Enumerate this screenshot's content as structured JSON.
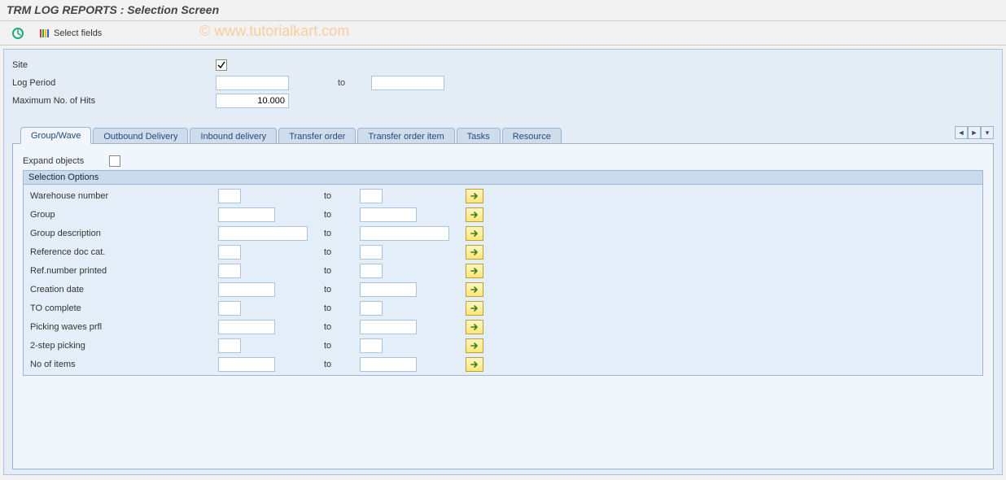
{
  "header": {
    "title": "TRM LOG REPORTS : Selection Screen"
  },
  "toolbar": {
    "select_fields": "Select fields"
  },
  "watermark": "© www.tutorialkart.com",
  "top": {
    "site_label": "Site",
    "site_checked": true,
    "log_period_label": "Log Period",
    "log_period_from": "",
    "to_label": "to",
    "log_period_to": "",
    "max_hits_label": "Maximum No. of Hits",
    "max_hits_value": "10.000"
  },
  "tabs": {
    "items": [
      {
        "label": "Group/Wave"
      },
      {
        "label": "Outbound Delivery"
      },
      {
        "label": "Inbound delivery"
      },
      {
        "label": "Transfer order"
      },
      {
        "label": "Transfer order item"
      },
      {
        "label": "Tasks"
      },
      {
        "label": "Resource"
      }
    ],
    "active_index": 0
  },
  "tab_body": {
    "expand_label": "Expand objects",
    "expand_checked": false,
    "group_title": "Selection Options",
    "to_label": "to",
    "rows": [
      {
        "label": "Warehouse number",
        "size": "s"
      },
      {
        "label": "Group",
        "size": "m"
      },
      {
        "label": "Group description",
        "size": "l"
      },
      {
        "label": "Reference doc cat.",
        "size": "s"
      },
      {
        "label": "Ref.number printed",
        "size": "s"
      },
      {
        "label": "Creation date",
        "size": "m"
      },
      {
        "label": "TO complete",
        "size": "s"
      },
      {
        "label": "Picking waves prfl",
        "size": "m"
      },
      {
        "label": "2-step picking",
        "size": "s"
      },
      {
        "label": "No of items",
        "size": "m"
      }
    ]
  }
}
